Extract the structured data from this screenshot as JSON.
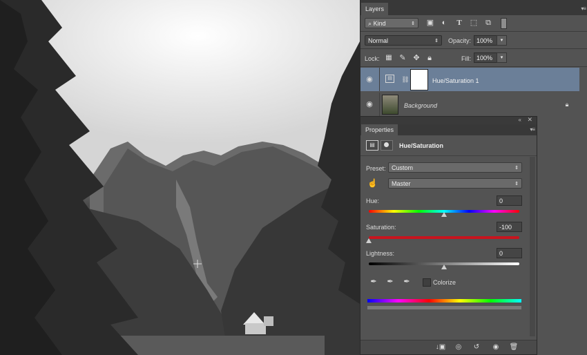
{
  "layers_panel": {
    "tab_label": "Layers",
    "menu_glyph": "▾≡",
    "kind_filter": {
      "label": "Kind",
      "search_glyph": "⌕"
    },
    "filter_icons": [
      "image-filter-icon",
      "adjustment-filter-icon",
      "type-filter-icon",
      "shape-filter-icon",
      "smart-object-filter-icon",
      "filter-toggle-icon"
    ],
    "blend_mode": "Normal",
    "opacity_label": "Opacity:",
    "opacity_value": "100%",
    "lock_label": "Lock:",
    "fill_label": "Fill:",
    "fill_value": "100%",
    "layers": [
      {
        "name": "Hue/Saturation 1",
        "selected": true
      },
      {
        "name": "Background",
        "selected": false,
        "locked": true
      }
    ]
  },
  "properties_panel": {
    "tab_label": "Properties",
    "title": "Hue/Saturation",
    "preset_label": "Preset:",
    "preset_value": "Custom",
    "channel_value": "Master",
    "hue_label": "Hue:",
    "hue_value": "0",
    "saturation_label": "Saturation:",
    "saturation_value": "-100",
    "lightness_label": "Lightness:",
    "lightness_value": "0",
    "colorize_label": "Colorize",
    "colorize_checked": false,
    "hue_slider_position": 0.5,
    "saturation_slider_position": 0.0,
    "lightness_slider_position": 0.5
  },
  "colors": {
    "panel_bg": "#535353",
    "selected_row": "#6b7f98",
    "saturation_track": "#c8141e"
  }
}
